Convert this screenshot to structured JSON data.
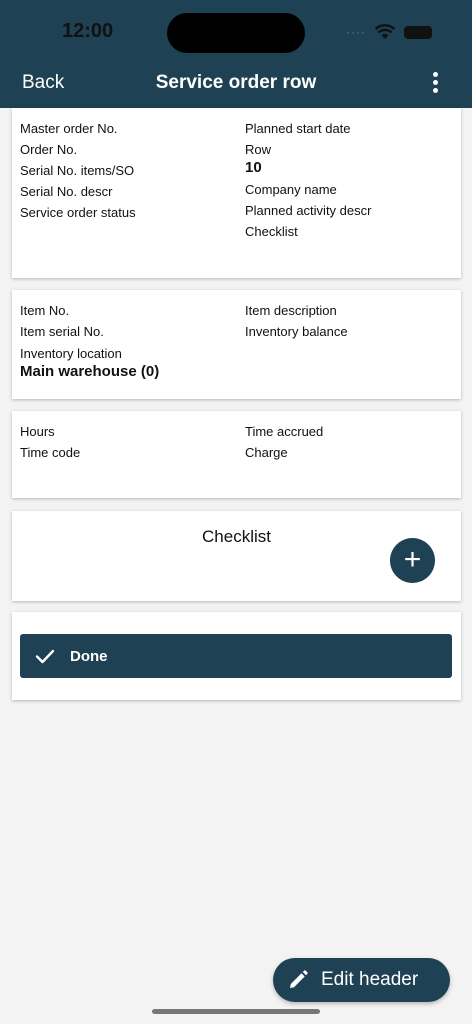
{
  "status_bar": {
    "time": "12:00",
    "signal": "····"
  },
  "header": {
    "back_label": "Back",
    "title": "Service order row"
  },
  "card_order": {
    "left": [
      "Master order No.",
      "Order No.",
      "Serial No. items/SO",
      "Serial No. descr",
      "Service order status"
    ],
    "right_top": [
      "Planned start date",
      "Row"
    ],
    "row_value": "10",
    "right_bottom": [
      "Company name",
      "Planned activity descr",
      "Checklist"
    ]
  },
  "card_item": {
    "left_fields": [
      "Item No.",
      "Item serial No.",
      "Inventory location"
    ],
    "location_value": "Main warehouse (0)",
    "right": [
      "Item description",
      "Inventory balance"
    ]
  },
  "card_time": {
    "left": [
      "Hours",
      "Time code"
    ],
    "right": [
      "Time accrued",
      "Charge"
    ]
  },
  "checklist": {
    "title": "Checklist",
    "add_symbol": "+"
  },
  "done": {
    "label": "Done"
  },
  "edit_header": {
    "label": "Edit header"
  },
  "colors": {
    "primary": "#1e4154",
    "background": "#f3f3f3",
    "card": "#ffffff"
  }
}
